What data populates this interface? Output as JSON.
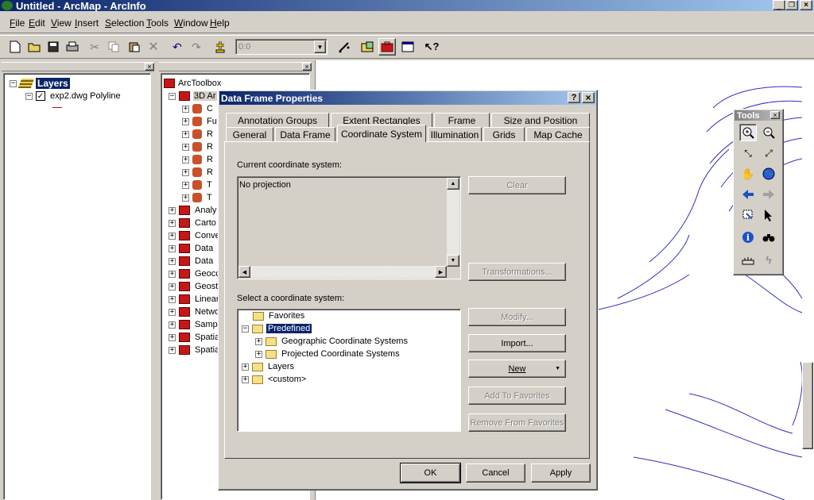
{
  "window": {
    "title": "Untitled - ArcMap - ArcInfo"
  },
  "menu": [
    {
      "pre": "",
      "u": "F",
      "post": "ile"
    },
    {
      "pre": "",
      "u": "E",
      "post": "dit"
    },
    {
      "pre": "",
      "u": "V",
      "post": "iew"
    },
    {
      "pre": "",
      "u": "I",
      "post": "nsert"
    },
    {
      "pre": "",
      "u": "S",
      "post": "election"
    },
    {
      "pre": "",
      "u": "T",
      "post": "ools"
    },
    {
      "pre": "",
      "u": "W",
      "post": "indow"
    },
    {
      "pre": "",
      "u": "H",
      "post": "elp"
    }
  ],
  "toolbar": {
    "scale_value": "0:0"
  },
  "toc": {
    "root": "Layers",
    "layer": "exp2.dwg Polyline"
  },
  "toolbox": {
    "root": "ArcToolbox",
    "first": "3D Ar",
    "sub_items": [
      "C",
      "Fu",
      "R",
      "R",
      "R",
      "R",
      "T",
      "T"
    ],
    "items": [
      "Analy",
      "Carto",
      "Conve",
      "Data",
      "Data",
      "Geocc",
      "Geost",
      "Linear",
      "Netwo",
      "Samp",
      "Spatia",
      "Spatia"
    ]
  },
  "dialog": {
    "title": "Data Frame Properties",
    "tabs_back": [
      "Annotation Groups",
      "Extent Rectangles",
      "Frame",
      "Size and Position"
    ],
    "tabs_front": [
      "General",
      "Data Frame",
      "Coordinate System",
      "Illumination",
      "Grids",
      "Map Cache"
    ],
    "current_label": "Current coordinate system:",
    "current_value": "No projection",
    "clear": "Clear",
    "transformations": "Transformations...",
    "select_label": "Select a coordinate system:",
    "tree": {
      "favorites": "Favorites",
      "predefined": "Predefined",
      "geographic": "Geographic Coordinate Systems",
      "projected": "Projected Coordinate Systems",
      "layers": "Layers",
      "custom": "<custom>"
    },
    "modify": "Modify...",
    "import": "Import...",
    "new": "New",
    "add_fav": "Add To Favorites",
    "remove_fav": "Remove From Favorites",
    "ok": "OK",
    "cancel": "Cancel",
    "apply": "Apply"
  },
  "tools": {
    "title": "Tools"
  }
}
